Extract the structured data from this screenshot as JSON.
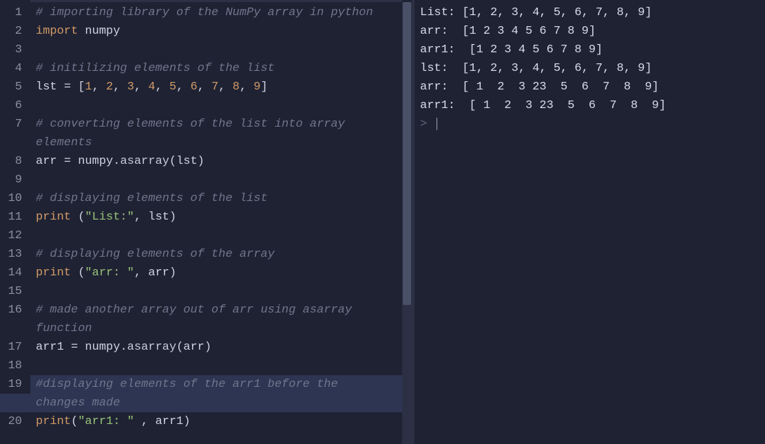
{
  "editor": {
    "lines": [
      {
        "num": "1",
        "tokens": [
          {
            "c": "comment",
            "t": "# importing library of the NumPy array in python"
          }
        ]
      },
      {
        "num": "2",
        "tokens": [
          {
            "c": "kw",
            "t": "import"
          },
          {
            "c": "ident",
            "t": " numpy"
          }
        ]
      },
      {
        "num": "3",
        "tokens": []
      },
      {
        "num": "4",
        "tokens": [
          {
            "c": "comment",
            "t": "# initilizing elements of the list"
          }
        ]
      },
      {
        "num": "5",
        "tokens": [
          {
            "c": "ident",
            "t": "lst "
          },
          {
            "c": "punct",
            "t": "= ["
          },
          {
            "c": "num",
            "t": "1"
          },
          {
            "c": "punct",
            "t": ", "
          },
          {
            "c": "num",
            "t": "2"
          },
          {
            "c": "punct",
            "t": ", "
          },
          {
            "c": "num",
            "t": "3"
          },
          {
            "c": "punct",
            "t": ", "
          },
          {
            "c": "num",
            "t": "4"
          },
          {
            "c": "punct",
            "t": ", "
          },
          {
            "c": "num",
            "t": "5"
          },
          {
            "c": "punct",
            "t": ", "
          },
          {
            "c": "num",
            "t": "6"
          },
          {
            "c": "punct",
            "t": ", "
          },
          {
            "c": "num",
            "t": "7"
          },
          {
            "c": "punct",
            "t": ", "
          },
          {
            "c": "num",
            "t": "8"
          },
          {
            "c": "punct",
            "t": ", "
          },
          {
            "c": "num",
            "t": "9"
          },
          {
            "c": "punct",
            "t": "]"
          }
        ]
      },
      {
        "num": "6",
        "tokens": []
      },
      {
        "num": "7",
        "tokens": [
          {
            "c": "comment",
            "t": "# converting elements of the list into array "
          }
        ]
      },
      {
        "num": "",
        "wrap": true,
        "tokens": [
          {
            "c": "comment",
            "t": "elements"
          }
        ]
      },
      {
        "num": "8",
        "tokens": [
          {
            "c": "ident",
            "t": "arr "
          },
          {
            "c": "punct",
            "t": "= "
          },
          {
            "c": "ident",
            "t": "numpy"
          },
          {
            "c": "punct",
            "t": "."
          },
          {
            "c": "func",
            "t": "asarray"
          },
          {
            "c": "punct",
            "t": "("
          },
          {
            "c": "ident",
            "t": "lst"
          },
          {
            "c": "punct",
            "t": ")"
          }
        ]
      },
      {
        "num": "9",
        "tokens": []
      },
      {
        "num": "10",
        "tokens": [
          {
            "c": "comment",
            "t": "# displaying elements of the list"
          }
        ]
      },
      {
        "num": "11",
        "tokens": [
          {
            "c": "kw",
            "t": "print"
          },
          {
            "c": "punct",
            "t": " ("
          },
          {
            "c": "str",
            "t": "\"List:\""
          },
          {
            "c": "punct",
            "t": ", "
          },
          {
            "c": "ident",
            "t": "lst"
          },
          {
            "c": "punct",
            "t": ")"
          }
        ]
      },
      {
        "num": "12",
        "tokens": []
      },
      {
        "num": "13",
        "tokens": [
          {
            "c": "comment",
            "t": "# displaying elements of the array"
          }
        ]
      },
      {
        "num": "14",
        "tokens": [
          {
            "c": "kw",
            "t": "print"
          },
          {
            "c": "punct",
            "t": " ("
          },
          {
            "c": "str",
            "t": "\"arr: \""
          },
          {
            "c": "punct",
            "t": ", "
          },
          {
            "c": "ident",
            "t": "arr"
          },
          {
            "c": "punct",
            "t": ")"
          }
        ]
      },
      {
        "num": "15",
        "tokens": []
      },
      {
        "num": "16",
        "tokens": [
          {
            "c": "comment",
            "t": "# made another array out of arr using asarray "
          }
        ]
      },
      {
        "num": "",
        "wrap": true,
        "tokens": [
          {
            "c": "comment",
            "t": "function"
          }
        ]
      },
      {
        "num": "17",
        "tokens": [
          {
            "c": "ident",
            "t": "arr1 "
          },
          {
            "c": "punct",
            "t": "= "
          },
          {
            "c": "ident",
            "t": "numpy"
          },
          {
            "c": "punct",
            "t": "."
          },
          {
            "c": "func",
            "t": "asarray"
          },
          {
            "c": "punct",
            "t": "("
          },
          {
            "c": "ident",
            "t": "arr"
          },
          {
            "c": "punct",
            "t": ")"
          }
        ]
      },
      {
        "num": "18",
        "tokens": []
      },
      {
        "num": "19",
        "selected": true,
        "tokens": [
          {
            "c": "comment",
            "t": "#displaying elements of the arr1 before the "
          }
        ]
      },
      {
        "num": "",
        "wrap": true,
        "selected": true,
        "tokens": [
          {
            "c": "comment",
            "t": "changes made"
          }
        ]
      },
      {
        "num": "20",
        "tokens": [
          {
            "c": "kw",
            "t": "print"
          },
          {
            "c": "punct",
            "t": "("
          },
          {
            "c": "str",
            "t": "\"arr1: \""
          },
          {
            "c": "punct",
            "t": " , "
          },
          {
            "c": "ident",
            "t": "arr1"
          },
          {
            "c": "punct",
            "t": ")"
          }
        ]
      }
    ]
  },
  "output": {
    "lines": [
      "List: [1, 2, 3, 4, 5, 6, 7, 8, 9]",
      "arr:  [1 2 3 4 5 6 7 8 9]",
      "arr1:  [1 2 3 4 5 6 7 8 9]",
      "lst:  [1, 2, 3, 4, 5, 6, 7, 8, 9]",
      "arr:  [ 1  2  3 23  5  6  7  8  9]",
      "arr1:  [ 1  2  3 23  5  6  7  8  9]"
    ],
    "prompt": "> "
  }
}
